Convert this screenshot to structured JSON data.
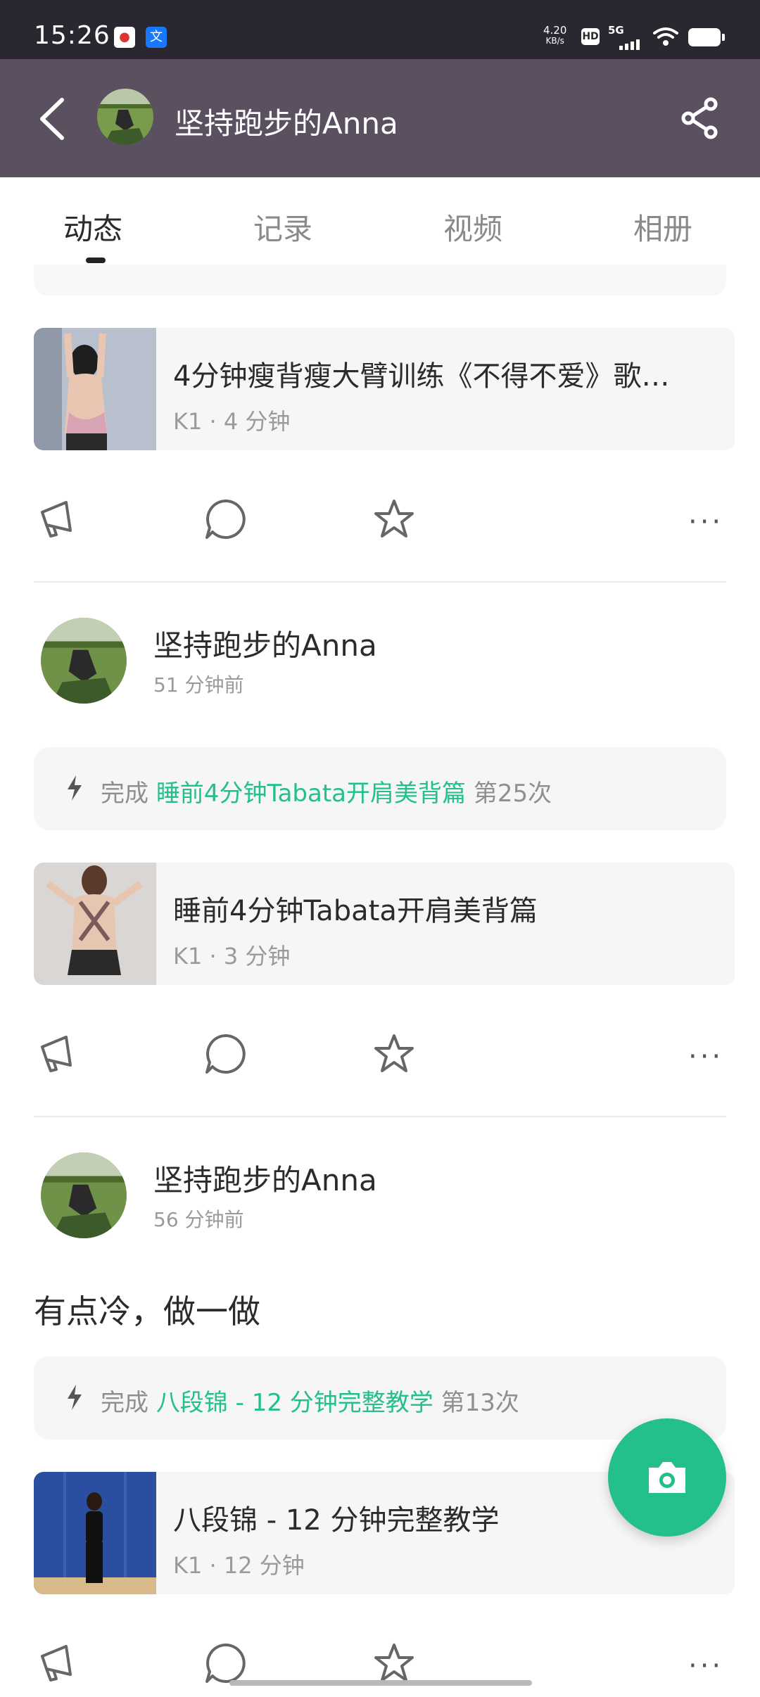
{
  "status_bar": {
    "time": "15:26",
    "net_speed_value": "4.20",
    "net_speed_unit": "KB/s",
    "hd": "HD",
    "network": "5G"
  },
  "header": {
    "title": "坚持跑步的Anna"
  },
  "tabs": [
    {
      "label": "动态",
      "active": true
    },
    {
      "label": "记录",
      "active": false
    },
    {
      "label": "视频",
      "active": false
    },
    {
      "label": "相册",
      "active": false
    }
  ],
  "feed": [
    {
      "card": {
        "title": "4分钟瘦背瘦大臂训练《不得不爱》歌…",
        "meta": "K1 · 4 分钟"
      }
    },
    {
      "author": "坚持跑步的Anna",
      "time": "51 分钟前",
      "done": {
        "prefix": "完成",
        "course": "睡前4分钟Tabata开肩美背篇",
        "count": "第25次"
      },
      "card": {
        "title": "睡前4分钟Tabata开肩美背篇",
        "meta": "K1 · 3 分钟"
      }
    },
    {
      "author": "坚持跑步的Anna",
      "time": "56 分钟前",
      "text": "有点冷，做一做",
      "done": {
        "prefix": "完成",
        "course": "八段锦 - 12 分钟完整教学",
        "count": "第13次"
      },
      "card": {
        "title": "八段锦 - 12 分钟完整教学",
        "meta": "K1 · 12 分钟"
      }
    }
  ],
  "more_label": "···",
  "colors": {
    "accent": "#24c08a",
    "header": "#5a5060",
    "status_bar": "#2a2730"
  }
}
